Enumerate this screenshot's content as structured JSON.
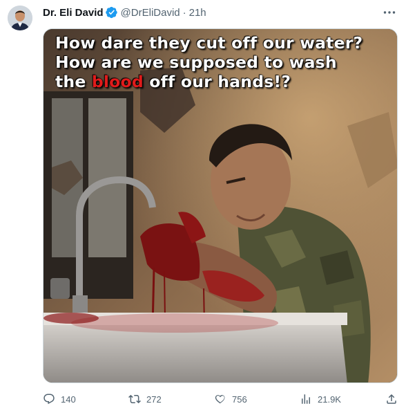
{
  "tweet": {
    "display_name": "Dr. Eli David",
    "handle": "@DrEliDavid",
    "separator": "·",
    "time": "21h",
    "verified": true,
    "avatar_icon": "avatar",
    "more_icon": "more-icon",
    "image_caption": {
      "line1": "How dare they cut off our water?",
      "line2": "How are we supposed to wash",
      "line3_before": "the ",
      "line3_highlight": "blood",
      "line3_after": " off our hands!?"
    },
    "actions": {
      "replies": "140",
      "retweets": "272",
      "likes": "756",
      "views": "21.9K"
    }
  },
  "colors": {
    "verified_blue": "#1d9bf0",
    "muted_text": "#536471",
    "caption_highlight": "#e01b1b"
  }
}
